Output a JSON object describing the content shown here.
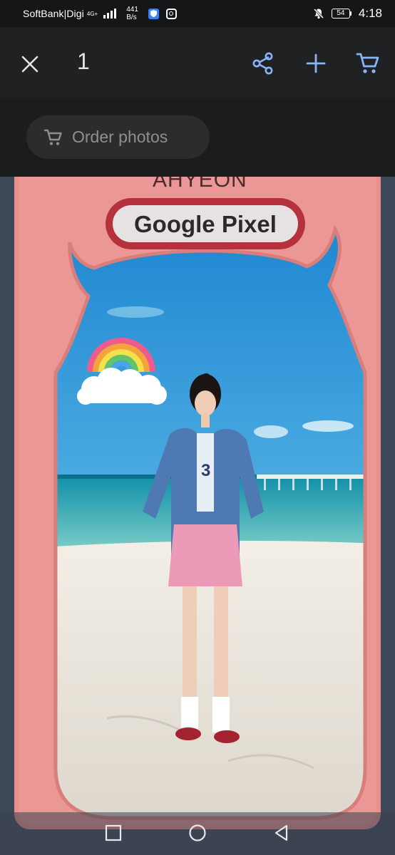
{
  "status_bar": {
    "carrier": "SoftBank|Digi",
    "network_type": "4G+",
    "speed_value": "441",
    "speed_unit": "B/s",
    "battery": "54",
    "time": "4:18"
  },
  "toolbar": {
    "selected_count": "1"
  },
  "order": {
    "label": "Order photos"
  },
  "photo": {
    "name_text": "AHYEON",
    "sign_text": "Google Pixel"
  },
  "colors": {
    "accent_blue": "#8ab4f8",
    "frame_pink": "#e8908e",
    "sky_blue": "#3a9bd4"
  }
}
